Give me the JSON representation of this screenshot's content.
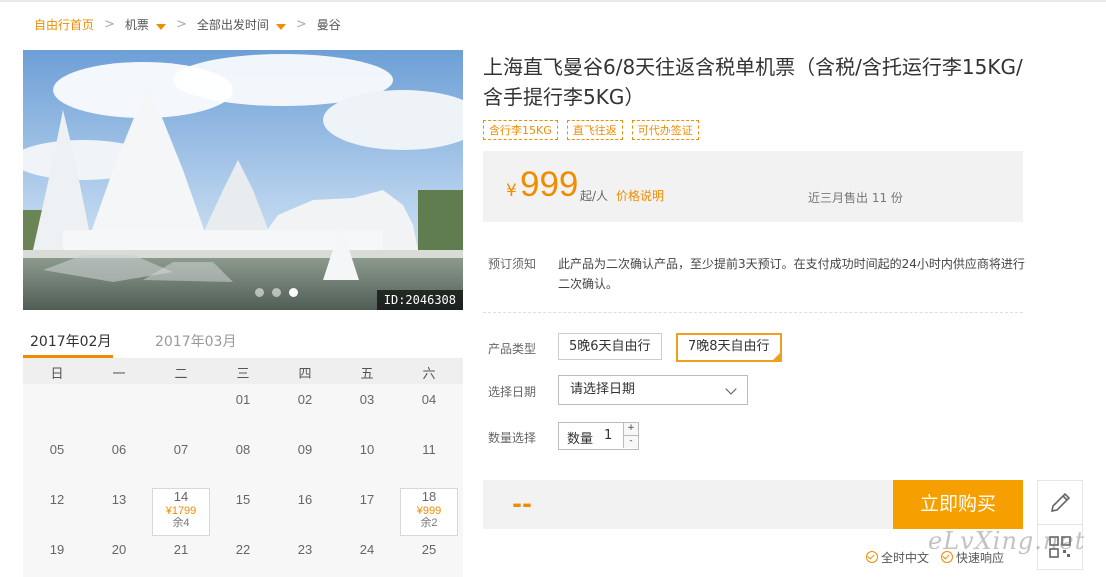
{
  "breadcrumb": {
    "home": "自由行首页",
    "items": [
      "机票",
      "全部出发时间",
      "曼谷"
    ],
    "separator": ">"
  },
  "photo": {
    "id_label": "ID:2046308",
    "slides": 3,
    "active_slide": 3
  },
  "calendar": {
    "tabs": [
      "2017年02月",
      "2017年03月"
    ],
    "weekdays": [
      "日",
      "一",
      "二",
      "三",
      "四",
      "五",
      "六"
    ],
    "days": [
      "01",
      "02",
      "03",
      "04",
      "05",
      "06",
      "07",
      "08",
      "09",
      "10",
      "11",
      "12",
      "13",
      "14",
      "15",
      "16",
      "17",
      "18",
      "19",
      "20",
      "21",
      "22",
      "23",
      "24",
      "25"
    ],
    "special": {
      "d14": {
        "day": "14",
        "price": "¥1799",
        "remain": "余4"
      },
      "d18": {
        "day": "18",
        "price": "¥999",
        "remain": "余2"
      }
    }
  },
  "product": {
    "title": "上海直飞曼谷6/8天往返含税单机票（含税/含托运行李15KG/含手提行李5KG）",
    "tags": [
      "含行李15KG",
      "直飞往返",
      "可代办签证"
    ],
    "price": {
      "currency": "¥",
      "value": "999",
      "unit": "起/人",
      "explain_link": "价格说明",
      "sold": "近三月售出 11 份"
    },
    "notice_label": "预订须知",
    "notice": "此产品为二次确认产品，至少提前3天预订。在支付成功时间起的24小时内供应商将进行二次确认。",
    "type_label": "产品类型",
    "types": [
      "5晚6天自由行",
      "7晚8天自由行"
    ],
    "selected_type": "7晚8天自由行",
    "date_label": "选择日期",
    "date_placeholder": "请选择日期",
    "qty_label": "数量选择",
    "qty_field_label": "数量",
    "qty_value": "1",
    "qty_up": "+",
    "qty_down": "-",
    "total": "--",
    "buy_button": "立即购买"
  },
  "badges": [
    "全时中文",
    "快速响应"
  ],
  "watermark": "eLvXing.net",
  "colors": {
    "accent": "#f08c00",
    "button": "#f5a000"
  }
}
